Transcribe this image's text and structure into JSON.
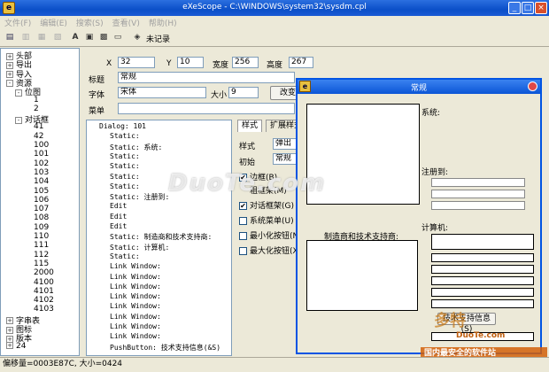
{
  "window": {
    "title": "eXeScope - C:\\WINDOWS\\system32\\sysdm.cpl"
  },
  "menu": [
    "文件(F)",
    "编辑(E)",
    "搜索(S)",
    "查看(V)",
    "帮助(H)"
  ],
  "toolbar": {
    "status_text": "未记录"
  },
  "tree": [
    {
      "label": "头部",
      "expander": "+"
    },
    {
      "label": "导出",
      "expander": "+"
    },
    {
      "label": "导入",
      "expander": "+"
    },
    {
      "label": "资源",
      "expander": "-"
    },
    {
      "label": "位图",
      "expander": "-"
    },
    {
      "label": "1",
      "expander": ""
    },
    {
      "label": "2",
      "expander": ""
    },
    {
      "label": "对话框",
      "expander": "-"
    },
    {
      "label": "41",
      "expander": ""
    },
    {
      "label": "42",
      "expander": ""
    },
    {
      "label": "100",
      "expander": ""
    },
    {
      "label": "101",
      "expander": ""
    },
    {
      "label": "102",
      "expander": ""
    },
    {
      "label": "103",
      "expander": ""
    },
    {
      "label": "104",
      "expander": ""
    },
    {
      "label": "105",
      "expander": ""
    },
    {
      "label": "106",
      "expander": ""
    },
    {
      "label": "107",
      "expander": ""
    },
    {
      "label": "108",
      "expander": ""
    },
    {
      "label": "109",
      "expander": ""
    },
    {
      "label": "110",
      "expander": ""
    },
    {
      "label": "111",
      "expander": ""
    },
    {
      "label": "112",
      "expander": ""
    },
    {
      "label": "115",
      "expander": ""
    },
    {
      "label": "2000",
      "expander": ""
    },
    {
      "label": "4100",
      "expander": ""
    },
    {
      "label": "4101",
      "expander": ""
    },
    {
      "label": "4102",
      "expander": ""
    },
    {
      "label": "4103",
      "expander": ""
    },
    {
      "label": "字串表",
      "expander": "+"
    },
    {
      "label": "图标",
      "expander": "+"
    },
    {
      "label": "版本",
      "expander": "+"
    },
    {
      "label": "24",
      "expander": "+"
    }
  ],
  "props": {
    "x_label": "X",
    "x_value": "32",
    "y_label": "Y",
    "y_value": "10",
    "width_label": "宽度",
    "width_value": "256",
    "height_label": "高度",
    "height_value": "267",
    "title_label": "标题",
    "title_value": "常规",
    "font_label": "字体",
    "font_value": "宋体",
    "size_label": "大小",
    "size_value": "9",
    "change_button": "改变",
    "menu_label": "菜单",
    "menu_value": ""
  },
  "resource_list": [
    "Dialog: 101",
    "Static:",
    "Static: 系统:",
    "Static:",
    "Static:",
    "Static:",
    "Static:",
    "Static: 注册到:",
    "Edit",
    "Edit",
    "Edit",
    "Static: 制造商和技术支持商:",
    "Static: 计算机:",
    "Static:",
    "Link Window:",
    "Link Window:",
    "Link Window:",
    "Link Window:",
    "Link Window:",
    "Link Window:",
    "Link Window:",
    "Link Window:",
    "PushButton: 技术支持信息(&S)"
  ],
  "style_panel": {
    "tab_style": "样式",
    "tab_ext": "扩展样式",
    "style_label": "样式",
    "style_value": "弹出",
    "init_label": "初始",
    "init_value": "常规",
    "checks": [
      {
        "label": "边框(B)",
        "checked": true
      },
      {
        "label": "粗框架(M)",
        "checked": false
      },
      {
        "label": "对话框架(G)",
        "checked": true
      },
      {
        "label": "系统菜单(U)",
        "checked": false
      },
      {
        "label": "最小化按钮(N)",
        "checked": false
      },
      {
        "label": "最大化按钮(X)",
        "checked": false
      }
    ]
  },
  "preview": {
    "title": "常规",
    "system_label": "系统:",
    "registered_label": "注册到:",
    "manufacturer_label": "制造商和技术支持商:",
    "computer_label": "计算机:",
    "support_button": "技术支持信息(S)"
  },
  "watermarks": {
    "main": "DuoTe.com",
    "corner_logo": "多特",
    "site": "DuoTe.com",
    "banner": "国内最安全的软件站"
  },
  "status": {
    "text": "偏移量=0003E87C, 大小=0424"
  }
}
